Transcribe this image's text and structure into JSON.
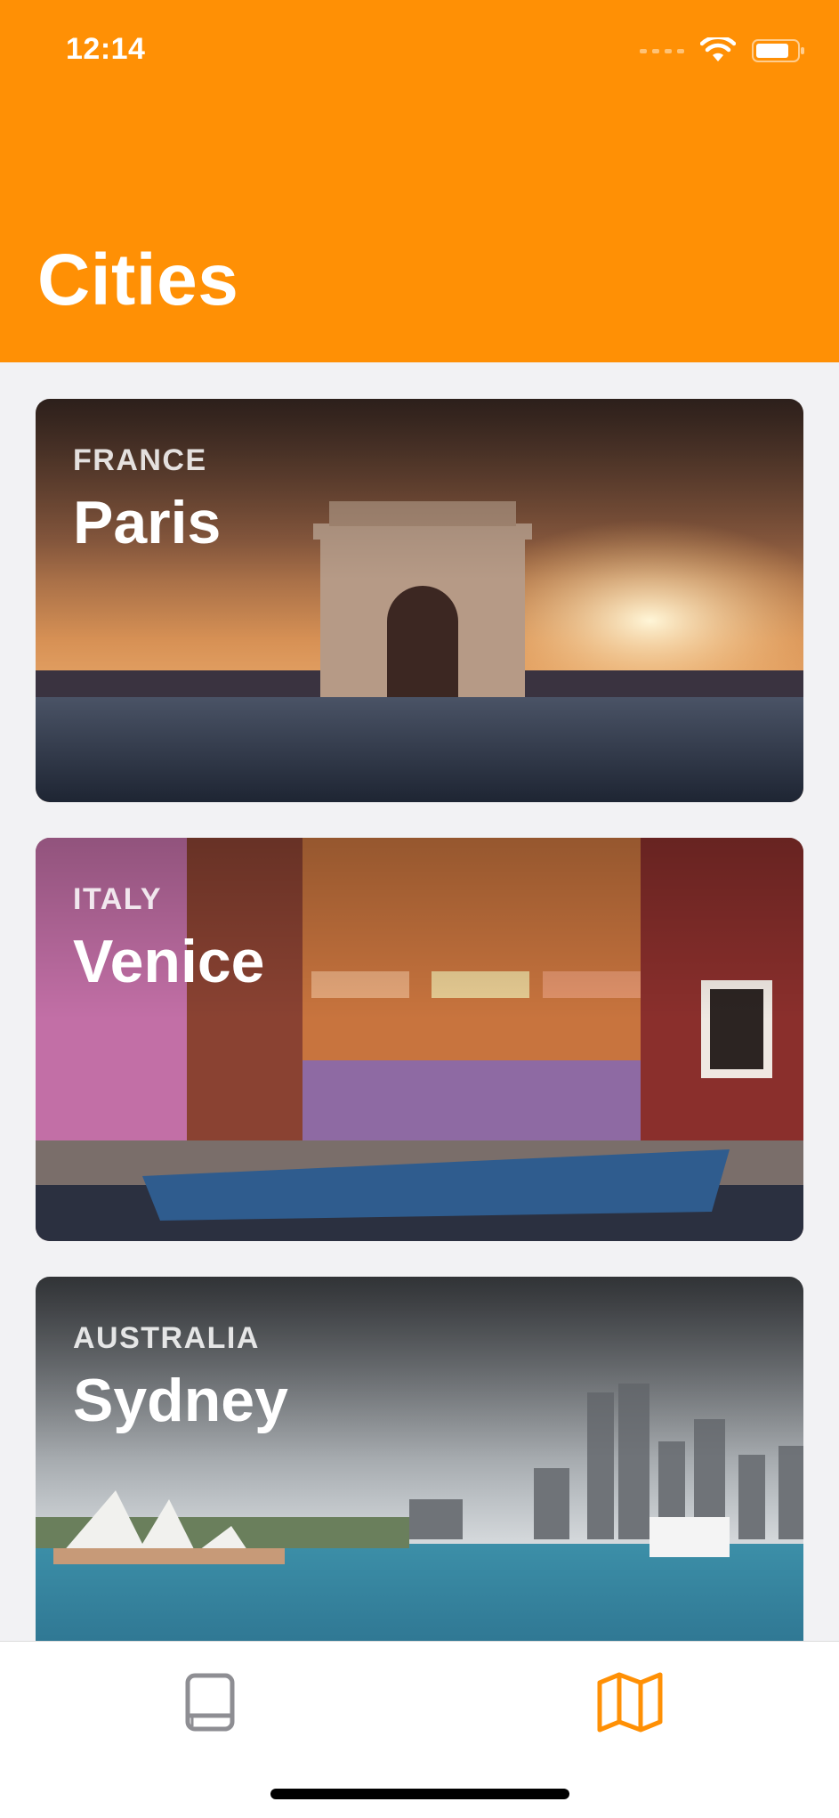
{
  "status_bar": {
    "time": "12:14"
  },
  "header": {
    "title": "Cities",
    "background_color": "#ff9005"
  },
  "cards": [
    {
      "country": "FRANCE",
      "city": "Paris"
    },
    {
      "country": "ITALY",
      "city": "Venice"
    },
    {
      "country": "AUSTRALIA",
      "city": "Sydney"
    }
  ],
  "tab_bar": {
    "tabs": [
      {
        "icon": "book-icon",
        "selected": false,
        "color": "#8e8e93"
      },
      {
        "icon": "map-icon",
        "selected": true,
        "color": "#ff9005"
      }
    ]
  }
}
